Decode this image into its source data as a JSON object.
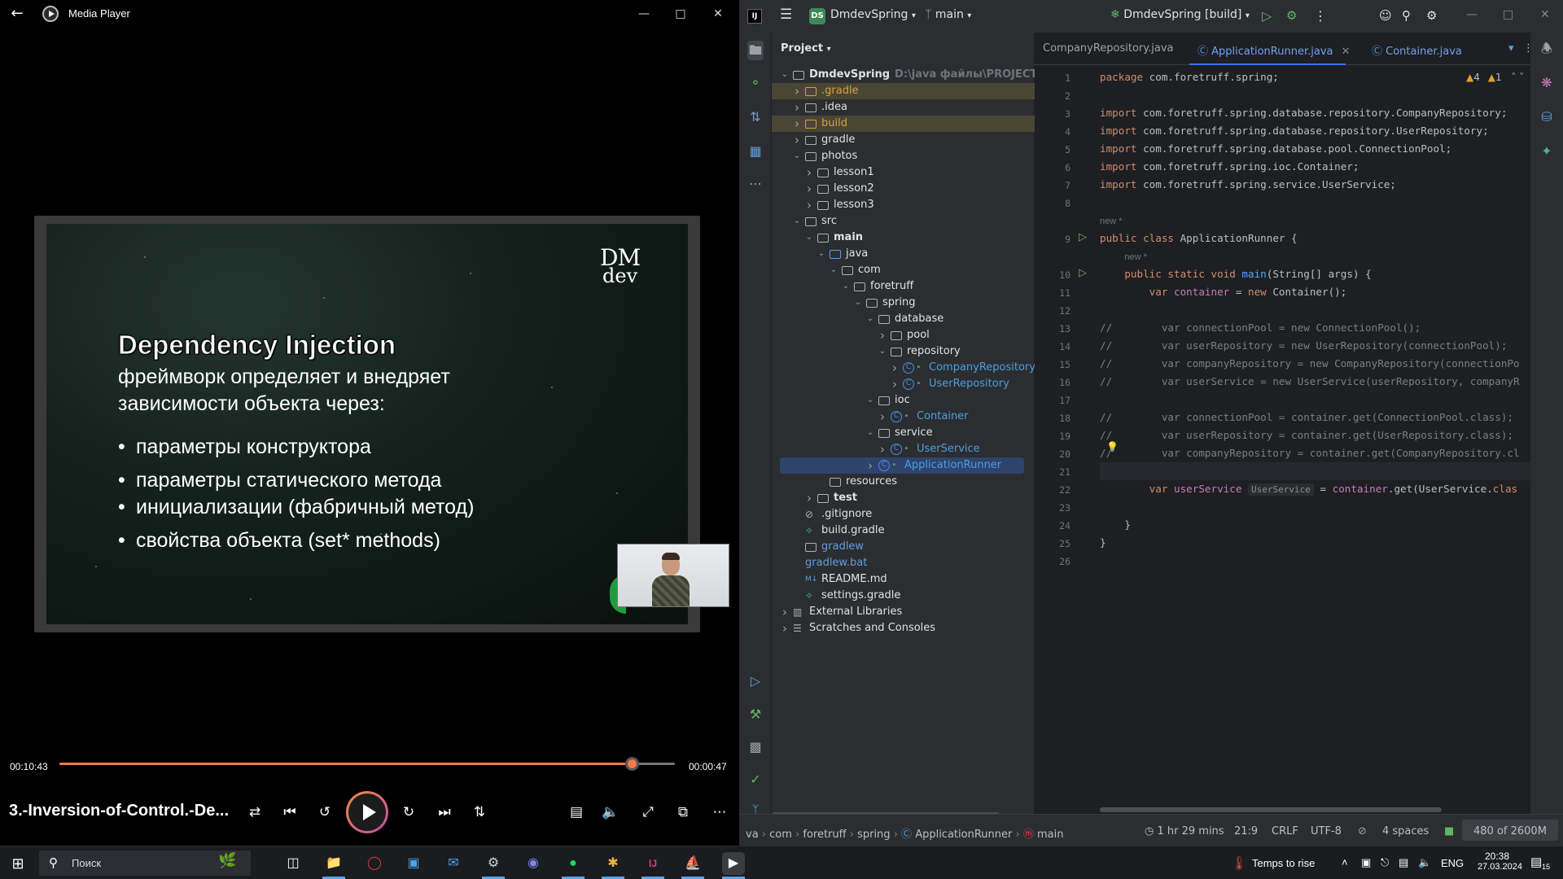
{
  "media_player": {
    "window_title": "Media Player",
    "slide": {
      "logo_line1": "DM",
      "logo_line2": "dev",
      "heading": "Dependency Injection",
      "subtitle_line1": "фреймворк определяет и внедряет",
      "subtitle_line2": "зависимости объекта через:",
      "bullets": [
        "параметры конструктора",
        "параметры статического метода",
        "инициализации (фабричный метод)",
        "свойства объекта (set* methods)"
      ]
    },
    "time_elapsed": "00:10:43",
    "time_remaining": "00:00:47",
    "progress_fraction": 0.93,
    "track_name": "3.-Inversion-of-Control.-De...",
    "accent_color": "#f37a49"
  },
  "ide": {
    "project_name": "DmdevSpring",
    "project_badge": "DS",
    "branch": "main",
    "run_config": "DmdevSpring [build]",
    "project_panel_title": "Project",
    "tree": [
      {
        "label": "DmdevSpring",
        "hint": "D:\\java файлы\\PROJECTS\\Dmd",
        "depth": 0,
        "chev": "down",
        "icon": "folder",
        "bold": true
      },
      {
        "label": ".gradle",
        "depth": 1,
        "chev": "right",
        "icon": "folder-yellow",
        "color": "#d6a23e",
        "highlight": "orange"
      },
      {
        "label": ".idea",
        "depth": 1,
        "chev": "right",
        "icon": "folder"
      },
      {
        "label": "build",
        "depth": 1,
        "chev": "right",
        "icon": "folder-yellow",
        "color": "#d6a23e",
        "highlight": "orange"
      },
      {
        "label": "gradle",
        "depth": 1,
        "chev": "right",
        "icon": "folder"
      },
      {
        "label": "photos",
        "depth": 1,
        "chev": "down",
        "icon": "folder"
      },
      {
        "label": "lesson1",
        "depth": 2,
        "chev": "right",
        "icon": "folder"
      },
      {
        "label": "lesson2",
        "depth": 2,
        "chev": "right",
        "icon": "folder"
      },
      {
        "label": "lesson3",
        "depth": 2,
        "chev": "right",
        "icon": "folder"
      },
      {
        "label": "src",
        "depth": 1,
        "chev": "down",
        "icon": "folder"
      },
      {
        "label": "main",
        "depth": 2,
        "chev": "down",
        "icon": "folder",
        "bold": true
      },
      {
        "label": "java",
        "depth": 3,
        "chev": "down",
        "icon": "folder-blue"
      },
      {
        "label": "com",
        "depth": 4,
        "chev": "down",
        "icon": "folder"
      },
      {
        "label": "foretruff",
        "depth": 5,
        "chev": "down",
        "icon": "folder"
      },
      {
        "label": "spring",
        "depth": 6,
        "chev": "down",
        "icon": "folder"
      },
      {
        "label": "database",
        "depth": 7,
        "chev": "down",
        "icon": "folder"
      },
      {
        "label": "pool",
        "depth": 8,
        "chev": "right",
        "icon": "folder"
      },
      {
        "label": "repository",
        "depth": 8,
        "chev": "down",
        "icon": "folder"
      },
      {
        "label": "CompanyRepository",
        "depth": 9,
        "chev": "right",
        "icon": "class",
        "color": "#4a9ee0"
      },
      {
        "label": "UserRepository",
        "depth": 9,
        "chev": "right",
        "icon": "class",
        "color": "#4a9ee0"
      },
      {
        "label": "ioc",
        "depth": 7,
        "chev": "down",
        "icon": "folder"
      },
      {
        "label": "Container",
        "depth": 8,
        "chev": "right",
        "icon": "class",
        "color": "#4a9ee0"
      },
      {
        "label": "service",
        "depth": 7,
        "chev": "down",
        "icon": "folder"
      },
      {
        "label": "UserService",
        "depth": 8,
        "chev": "right",
        "icon": "class",
        "color": "#4a9ee0"
      },
      {
        "label": "ApplicationRunner",
        "depth": 7,
        "chev": "right",
        "icon": "class",
        "color": "#4a9ee0",
        "highlight": "selected"
      },
      {
        "label": "resources",
        "depth": 3,
        "chev": "",
        "icon": "folder"
      },
      {
        "label": "test",
        "depth": 2,
        "chev": "right",
        "icon": "folder",
        "bold": true
      },
      {
        "label": ".gitignore",
        "depth": 1,
        "chev": "",
        "icon": "ignore"
      },
      {
        "label": "build.gradle",
        "depth": 1,
        "chev": "",
        "icon": "gradle"
      },
      {
        "label": "gradlew",
        "depth": 1,
        "chev": "",
        "icon": "file",
        "color": "#5c9fe0"
      },
      {
        "label": "gradlew.bat",
        "depth": 1,
        "chev": "",
        "icon": "none",
        "color": "#5c9fe0"
      },
      {
        "label": "README.md",
        "depth": 1,
        "chev": "",
        "icon": "md"
      },
      {
        "label": "settings.gradle",
        "depth": 1,
        "chev": "",
        "icon": "gradle"
      },
      {
        "label": "External Libraries",
        "depth": 0,
        "chev": "right",
        "icon": "lib"
      },
      {
        "label": "Scratches and Consoles",
        "depth": 0,
        "chev": "right",
        "icon": "scratch"
      }
    ],
    "tabs": [
      {
        "label": "CompanyRepository.java",
        "active": false
      },
      {
        "label": "ApplicationRunner.java",
        "active": true
      },
      {
        "label": "Container.java",
        "active": false
      }
    ],
    "inspections": {
      "warnings": "4",
      "weak": "1"
    },
    "code_lines": [
      {
        "n": "1",
        "html": "<span class=\"k\">package</span> com.foretruff.spring;"
      },
      {
        "n": "2",
        "html": ""
      },
      {
        "n": "3",
        "html": "<span class=\"k\">import</span> com.foretruff.spring.database.repository.CompanyRepository;"
      },
      {
        "n": "4",
        "html": "<span class=\"k\">import</span> com.foretruff.spring.database.repository.UserRepository;"
      },
      {
        "n": "5",
        "html": "<span class=\"k\">import</span> com.foretruff.spring.database.pool.ConnectionPool;"
      },
      {
        "n": "6",
        "html": "<span class=\"k\">import</span> com.foretruff.spring.ioc.Container;"
      },
      {
        "n": "7",
        "html": "<span class=\"k\">import</span> com.foretruff.spring.service.UserService;"
      },
      {
        "n": "8",
        "html": ""
      },
      {
        "n": "",
        "html": "<span class=\"newhint\">new *</span>",
        "hint": true
      },
      {
        "n": "9",
        "html": "<span class=\"k\">public class</span> ApplicationRunner {",
        "run": true
      },
      {
        "n": "",
        "html": "    <span class=\"newhint\">new *</span>",
        "hint": true
      },
      {
        "n": "10",
        "html": "    <span class=\"k\">public static void</span> <span class=\"fn\">main</span>(String[] <span class=\"param\">args</span>) {",
        "run": true
      },
      {
        "n": "11",
        "html": "        <span class=\"k\">var</span> <span class=\"var\">container</span> = <span class=\"k\">new</span> Container();"
      },
      {
        "n": "12",
        "html": ""
      },
      {
        "n": "13",
        "html": "<span class=\"cmt\">//        var connectionPool = new ConnectionPool();</span>"
      },
      {
        "n": "14",
        "html": "<span class=\"cmt\">//        var userRepository = new UserRepository(connectionPool);</span>"
      },
      {
        "n": "15",
        "html": "<span class=\"cmt\">//        var companyRepository = new CompanyRepository(connectionPo</span>"
      },
      {
        "n": "16",
        "html": "<span class=\"cmt\">//        var userService = new UserService(userRepository, companyR</span>"
      },
      {
        "n": "17",
        "html": ""
      },
      {
        "n": "18",
        "html": "<span class=\"cmt\">//        var connectionPool = container.get(ConnectionPool.class);</span>"
      },
      {
        "n": "19",
        "html": "<span class=\"cmt\">//        var userRepository = container.get(UserRepository.class);</span>"
      },
      {
        "n": "20",
        "html": "<span class=\"cmt\">//        var companyRepository = container.get(CompanyRepository.cl</span>"
      },
      {
        "n": "21",
        "html": "",
        "current": true
      },
      {
        "n": "22",
        "html": "        <span class=\"k\">var</span> <span class=\"var\">userService</span> <span class=\"inlay\">UserService</span> = <span class=\"var\">container</span>.get(UserService.<span class=\"k\">clas</span>"
      },
      {
        "n": "23",
        "html": ""
      },
      {
        "n": "24",
        "html": "    }"
      },
      {
        "n": "25",
        "html": "}"
      },
      {
        "n": "26",
        "html": ""
      }
    ],
    "breadcrumbs": [
      "va",
      "com",
      "foretruff",
      "spring",
      "ApplicationRunner",
      "main"
    ],
    "status": {
      "time": "1 hr 29 mins",
      "position": "21:9",
      "line_sep": "CRLF",
      "encoding": "UTF-8",
      "indent": "4 spaces",
      "memory": "480 of 2600M"
    }
  },
  "taskbar": {
    "search_placeholder": "Поиск",
    "weather": "Temps to rise",
    "lang": "ENG",
    "time": "20:38",
    "date": "27.03.2024",
    "notif_count": "15"
  }
}
